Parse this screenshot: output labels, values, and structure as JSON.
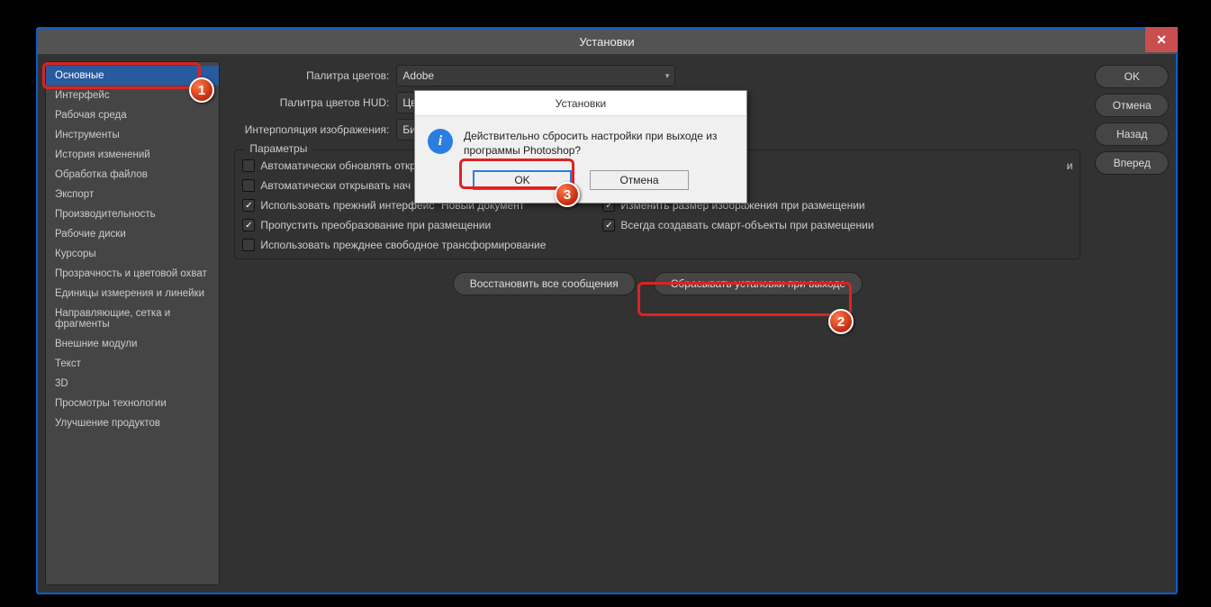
{
  "window": {
    "title": "Установки",
    "close_glyph": "✕"
  },
  "sidebar": {
    "items": [
      "Основные",
      "Интерфейс",
      "Рабочая среда",
      "Инструменты",
      "История изменений",
      "Обработка файлов",
      "Экспорт",
      "Производительность",
      "Рабочие диски",
      "Курсоры",
      "Прозрачность и цветовой охват",
      "Единицы измерения и линейки",
      "Направляющие, сетка и фрагменты",
      "Внешние модули",
      "Текст",
      "3D",
      "Просмотры технологии",
      "Улучшение продуктов"
    ],
    "selected_index": 0
  },
  "form": {
    "row1_label": "Палитра цветов:",
    "row1_value": "Adobe",
    "row2_label": "Палитра цветов HUD:",
    "row2_value": "Цв",
    "row3_label": "Интерполяция изображения:",
    "row3_value": "Би"
  },
  "params": {
    "legend": "Параметры",
    "left": [
      {
        "label": "Автоматически обновлять откр",
        "checked": false
      },
      {
        "label": "Автоматически открывать нач",
        "checked": false
      },
      {
        "label": "Использовать прежний интерфейс \"Новый документ\"",
        "checked": true
      },
      {
        "label": "Пропустить преобразование при размещении",
        "checked": true
      },
      {
        "label": "Использовать прежднее свободное трансформирование",
        "checked": false
      }
    ],
    "right": [
      {
        "label": "",
        "checked": false,
        "suffix": "и"
      },
      {
        "label": "Изменить размер изображения при размещении",
        "checked": true
      },
      {
        "label": "Всегда создавать смарт-объекты при размещении",
        "checked": true
      }
    ]
  },
  "buttons": {
    "restore": "Восстановить все сообщения",
    "reset": "Сбрасывать установки при выходе"
  },
  "right_panel": {
    "ok": "OK",
    "cancel": "Отмена",
    "back": "Назад",
    "forward": "Вперед"
  },
  "dialog": {
    "title": "Установки",
    "text": "Действительно сбросить настройки при выходе из программы Photoshop?",
    "ok": "OK",
    "cancel": "Отмена"
  },
  "badges": {
    "n1": "1",
    "n2": "2",
    "n3": "3"
  }
}
